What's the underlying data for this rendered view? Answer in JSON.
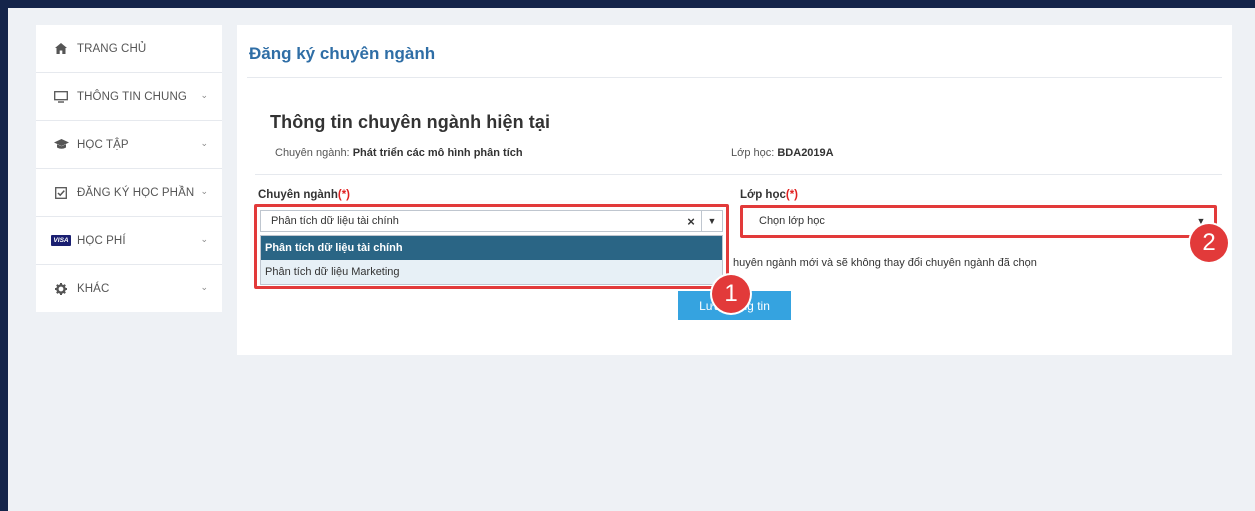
{
  "sidebar": {
    "items": [
      {
        "label": "TRANG CHỦ",
        "icon": "home-icon",
        "has_chevron": false
      },
      {
        "label": "THÔNG TIN CHUNG",
        "icon": "monitor-icon",
        "has_chevron": true
      },
      {
        "label": "HỌC TẬP",
        "icon": "graduation-cap-icon",
        "has_chevron": true
      },
      {
        "label": "ĐĂNG KÝ HỌC PHẦN",
        "icon": "checkbox-icon",
        "has_chevron": true
      },
      {
        "label": "HỌC PHÍ",
        "icon": "visa-card-icon",
        "has_chevron": true
      },
      {
        "label": "KHÁC",
        "icon": "gear-icon",
        "has_chevron": true
      }
    ],
    "visa_text": "VISA"
  },
  "page": {
    "title": "Đăng ký chuyên ngành"
  },
  "current_info": {
    "heading": "Thông tin chuyên ngành hiện tại",
    "major_label": "Chuyên ngành:",
    "major_value": "Phát triển các mô hình phân tích",
    "class_label": "Lớp học:",
    "class_value": "BDA2019A"
  },
  "form": {
    "major_field": {
      "label": "Chuyên ngành",
      "required_mark": "(*)",
      "selected": "Phân tích dữ liệu tài chính",
      "clear_symbol": "×",
      "options": [
        "Phân tích dữ liệu tài chính",
        "Phân tích dữ liệu Marketing"
      ]
    },
    "class_field": {
      "label": "Lớp học",
      "required_mark": "(*)",
      "placeholder": "Chọn lớp học"
    },
    "note": "huyên ngành mới và sẽ không thay đổi chuyên ngành đã chọn",
    "save_label": "Lưu thông tin"
  },
  "annotations": {
    "badge_1": "1",
    "badge_2": "2",
    "color": "#e23a3a"
  },
  "colors": {
    "title_blue": "#2f6ea6",
    "button_blue": "#35a3e0",
    "dropdown_selected": "#2a6585",
    "frame": "#14244a"
  }
}
